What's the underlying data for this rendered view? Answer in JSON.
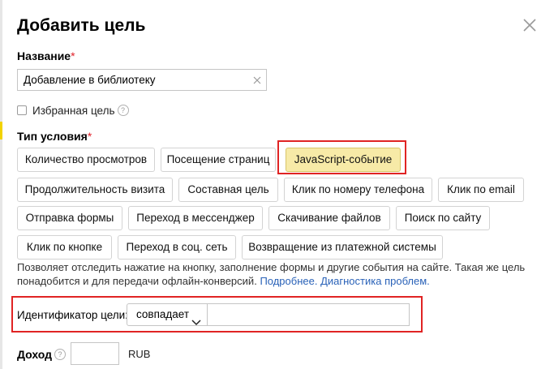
{
  "dialog": {
    "title": "Добавить цель",
    "close_icon": "close-icon"
  },
  "name": {
    "label": "Название",
    "required_mark": "*",
    "value": "Добавление в библиотеку"
  },
  "favorite": {
    "label": "Избранная цель",
    "checked": false,
    "help_glyph": "?"
  },
  "condition": {
    "label": "Тип условия",
    "required_mark": "*",
    "options": [
      "Количество просмотров",
      "Посещение страниц",
      "JavaScript-событие",
      "Продолжительность визита",
      "Составная цель",
      "Клик по номеру телефона",
      "Клик по email",
      "Отправка формы",
      "Переход в мессенджер",
      "Скачивание файлов",
      "Поиск по сайту",
      "Клик по кнопке",
      "Переход в соц. сеть",
      "Возвращение из платежной системы"
    ],
    "selected": "JavaScript-событие",
    "description": "Позволяет отследить нажатие на кнопку, заполнение формы и другие события на сайте. Такая же цель понадобится и для передачи офлайн-конверсий.",
    "link_more": "Подробнее.",
    "link_diagnostics": "Диагностика проблем."
  },
  "goal_id": {
    "label": "Идентификатор цели:",
    "match_value": "совпадает",
    "value": ""
  },
  "revenue": {
    "label": "Доход",
    "help_glyph": "?",
    "value": "",
    "currency": "RUB"
  },
  "colors": {
    "selected_option_bg": "#f7eaa7",
    "highlight_border": "#e02424",
    "link": "#2a62b8",
    "required": "#e0212a"
  }
}
